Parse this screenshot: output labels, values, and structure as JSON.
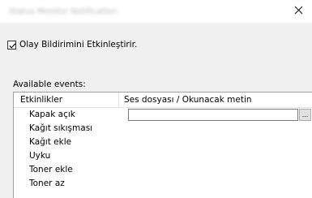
{
  "window": {
    "title": "Status Monitor Notification",
    "close_glyph": "✕"
  },
  "options": {
    "enable_event_notification": {
      "label": "Olay Bildirimini Etkinleştirir.",
      "checked": true
    }
  },
  "events": {
    "section_label": "Available events:",
    "columns": [
      "Etkinlikler",
      "Ses dosyası / Okunacak metin"
    ],
    "rows": [
      {
        "event": "Kapak açık",
        "value": ""
      },
      {
        "event": "Kağıt sıkışması"
      },
      {
        "event": "Kağıt ekle"
      },
      {
        "event": "Uyku"
      },
      {
        "event": "Toner ekle"
      },
      {
        "event": "Toner az"
      }
    ],
    "browse_label": "..."
  },
  "icons": {
    "close": "close-icon",
    "checkmark": "checkmark-icon"
  },
  "colors": {
    "dialog_background": "#f0f0f0",
    "list_background": "#ffffff",
    "border": "#a0a0a0"
  }
}
